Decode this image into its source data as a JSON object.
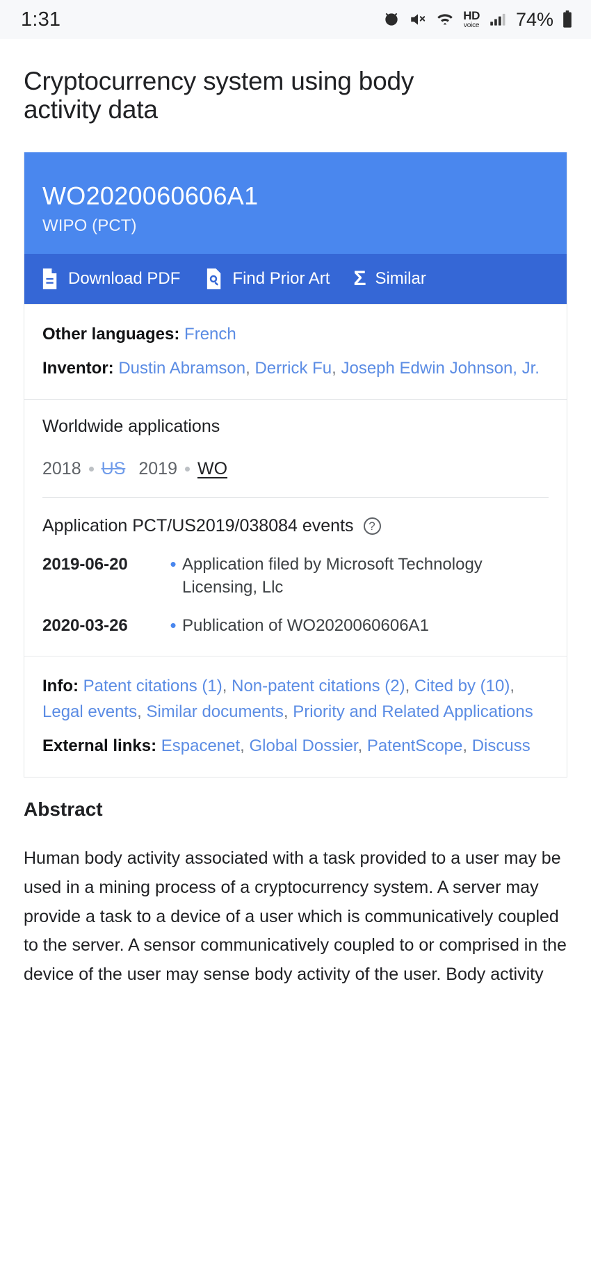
{
  "status_bar": {
    "time": "1:31",
    "battery": "74%",
    "hd_label": "HD",
    "voice_label": "voice",
    "icons": [
      "alarm-icon",
      "mute-icon",
      "wifi-icon",
      "hd-voice-icon",
      "signal-icon",
      "battery-icon"
    ]
  },
  "document": {
    "title": "Cryptocurrency system using body activity data"
  },
  "patent_card": {
    "publication_number": "WO2020060606A1",
    "office": "WIPO (PCT)",
    "actions": [
      {
        "label": "Download PDF",
        "icon": "pdf-document-icon"
      },
      {
        "label": "Find Prior Art",
        "icon": "search-document-icon"
      },
      {
        "label": "Similar",
        "icon": "sigma-icon",
        "glyph": "Σ"
      }
    ],
    "other_languages": {
      "label": "Other languages:",
      "links": [
        "French"
      ]
    },
    "inventor": {
      "label": "Inventor:",
      "links": [
        "Dustin Abramson",
        "Derrick Fu",
        "Joseph Edwin Johnson, Jr."
      ]
    },
    "worldwide_applications": {
      "heading": "Worldwide applications",
      "entries": [
        {
          "year": "2018",
          "code": "US",
          "state": "expired"
        },
        {
          "year": "2019",
          "code": "WO",
          "state": "current"
        }
      ]
    },
    "application_events": {
      "heading": "Application PCT/US2019/038084 events",
      "help_glyph": "?",
      "events": [
        {
          "date": "2019-06-20",
          "text": "Application filed by Microsoft Technology Licensing, Llc"
        },
        {
          "date": "2020-03-26",
          "text": "Publication of WO2020060606A1"
        }
      ]
    },
    "info": {
      "label": "Info:",
      "links": [
        "Patent citations (1)",
        "Non-patent citations (2)",
        "Cited by (10)",
        "Legal events",
        "Similar documents",
        "Priority and Related Applications"
      ]
    },
    "external_links": {
      "label": "External links:",
      "links": [
        "Espacenet",
        "Global Dossier",
        "PatentScope",
        "Discuss"
      ]
    }
  },
  "abstract": {
    "heading": "Abstract",
    "text": "Human body activity associated with a task provided to a user may be used in a mining process of a cryptocurrency system. A server may provide a task to a device of a user which is communicatively coupled to the server. A sensor communicatively coupled to or comprised in the device of the user may sense body activity of the user. Body activity"
  },
  "colors": {
    "header_blue": "#4a87ee",
    "action_blue": "#3567d6",
    "link_blue": "#5b8ce4",
    "text_primary": "#202124"
  }
}
